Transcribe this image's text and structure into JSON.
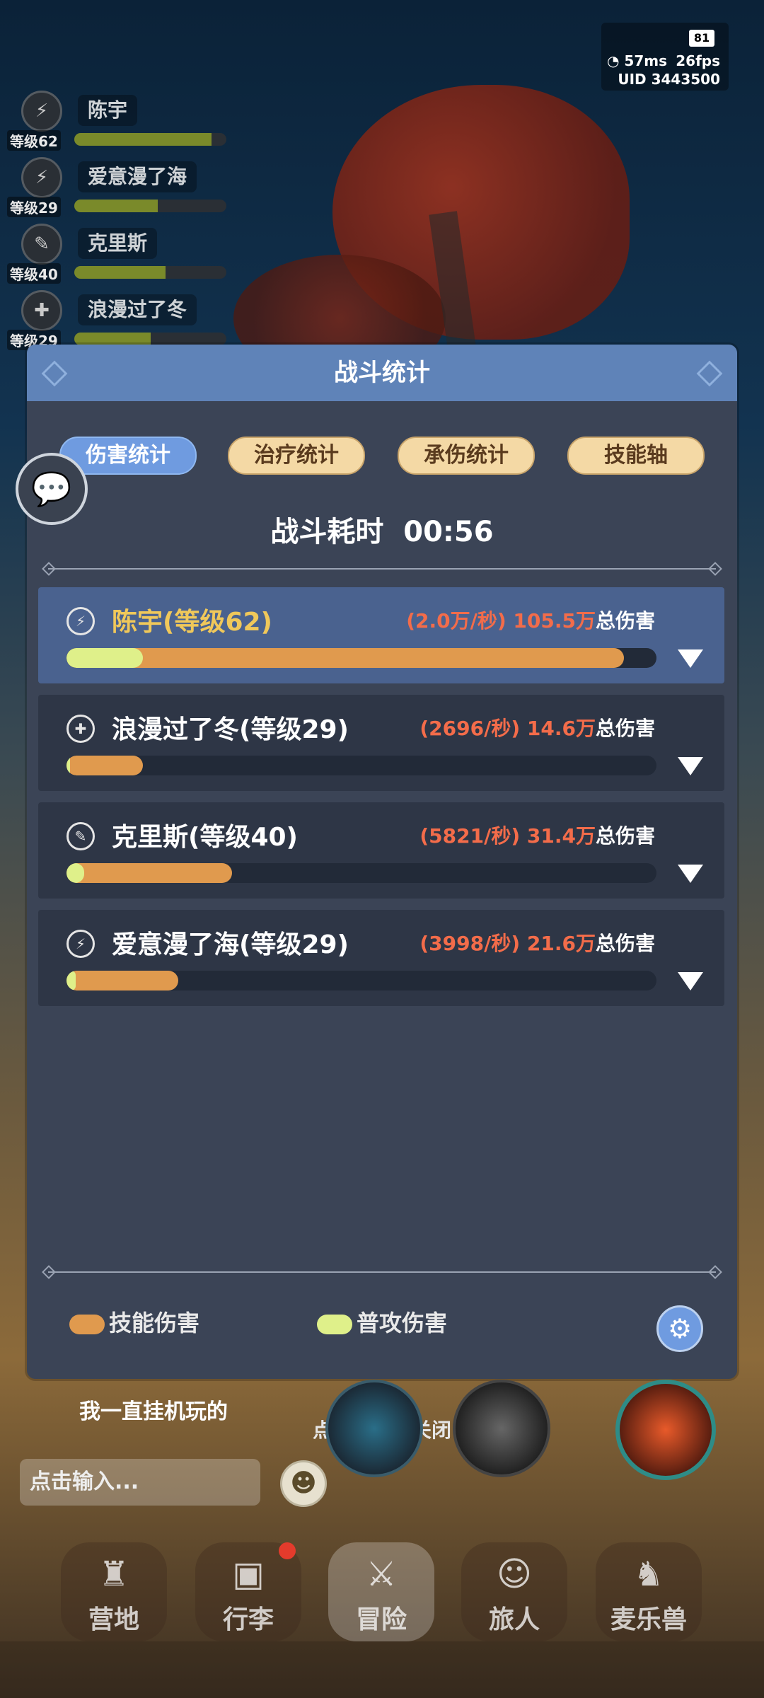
{
  "status": {
    "battery": "81",
    "ping": "57ms",
    "fps": "26fps",
    "uid": "UID  3443500"
  },
  "party": [
    {
      "name": "陈宇",
      "level": "等级62",
      "hp": 0.9
    },
    {
      "name": "爱意漫了海",
      "level": "等级29",
      "hp": 0.55
    },
    {
      "name": "克里斯",
      "level": "等级40",
      "hp": 0.6
    },
    {
      "name": "浪漫过了冬",
      "level": "等级29",
      "hp": 0.5
    }
  ],
  "panel": {
    "title": "战斗统计",
    "tabs": [
      "伤害统计",
      "治疗统计",
      "承伤统计",
      "技能轴"
    ],
    "active_tab": 0,
    "duration_label": "战斗耗时",
    "duration": "00:56",
    "rows": [
      {
        "name": "陈宇(等级62)",
        "dps": "(2.0万/秒)",
        "total": "105.5万",
        "total_label": "总伤害",
        "skill": 0.945,
        "normal": 0.13,
        "selected": true,
        "icon": "⚡"
      },
      {
        "name": "浪漫过了冬(等级29)",
        "dps": "(2696/秒)",
        "total": "14.6万",
        "total_label": "总伤害",
        "skill": 0.13,
        "normal": 0.005,
        "selected": false,
        "icon": "✚"
      },
      {
        "name": "克里斯(等级40)",
        "dps": "(5821/秒)",
        "total": "31.4万",
        "total_label": "总伤害",
        "skill": 0.28,
        "normal": 0.03,
        "selected": false,
        "icon": "✎"
      },
      {
        "name": "爱意漫了海(等级29)",
        "dps": "(3998/秒)",
        "total": "21.6万",
        "total_label": "总伤害",
        "skill": 0.19,
        "normal": 0.015,
        "selected": false,
        "icon": "⚡"
      }
    ],
    "legend": [
      {
        "label": "技能伤害",
        "color": "#e09a4e"
      },
      {
        "label": "普攻伤害",
        "color": "#dff08a"
      }
    ]
  },
  "chat": {
    "message": "我一直挂机玩的",
    "close_hint": "点击空白处关闭",
    "input_placeholder": "点击输入..."
  },
  "nav": [
    {
      "label": "营地",
      "icon": "castle-icon"
    },
    {
      "label": "行李",
      "icon": "chest-icon"
    },
    {
      "label": "冒险",
      "icon": "swords-icon"
    },
    {
      "label": "旅人",
      "icon": "person-icon"
    },
    {
      "label": "麦乐兽",
      "icon": "fox-icon"
    }
  ]
}
